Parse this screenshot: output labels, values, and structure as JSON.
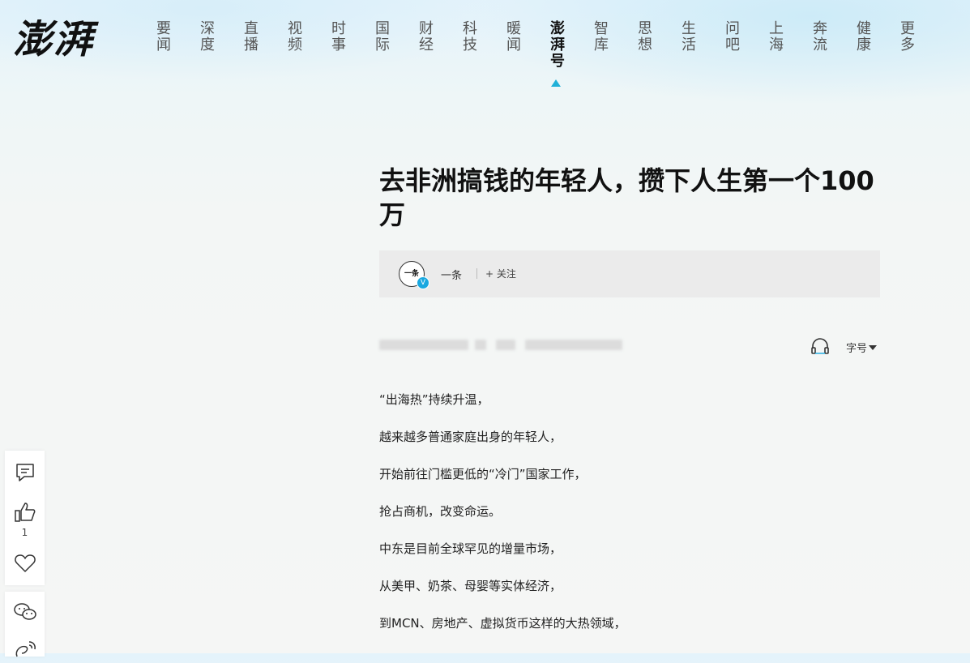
{
  "logo": "澎湃",
  "nav": [
    {
      "label": "要闻",
      "active": false
    },
    {
      "label": "深度",
      "active": false
    },
    {
      "label": "直播",
      "active": false
    },
    {
      "label": "视频",
      "active": false
    },
    {
      "label": "时事",
      "active": false
    },
    {
      "label": "国际",
      "active": false
    },
    {
      "label": "财经",
      "active": false
    },
    {
      "label": "科技",
      "active": false
    },
    {
      "label": "暖闻",
      "active": false
    },
    {
      "label": "澎湃号",
      "active": true
    },
    {
      "label": "智库",
      "active": false
    },
    {
      "label": "思想",
      "active": false
    },
    {
      "label": "生活",
      "active": false
    },
    {
      "label": "问吧",
      "active": false
    },
    {
      "label": "上海",
      "active": false
    },
    {
      "label": "奔流",
      "active": false
    },
    {
      "label": "健康",
      "active": false
    },
    {
      "label": "更多",
      "active": false
    }
  ],
  "article": {
    "title": "去非洲搞钱的年轻人，攒下人生第一个100万",
    "author": {
      "avatar_text": "一条",
      "verified_mark": "V",
      "name": "一条",
      "follow_label": "+ 关注"
    },
    "font_size_label": "字号",
    "paragraphs": [
      "“出海热”持续升温，",
      "越来越多普通家庭出身的年轻人，",
      "开始前往门槛更低的“冷门”国家工作，",
      "抢占商机，改变命运。",
      "中东是目前全球罕见的增量市场，",
      "从美甲、奶茶、母婴等实体经济，",
      "到MCN、房地产、虚拟货币这样的大热领域，"
    ]
  },
  "sidebar": {
    "like_count": "1"
  },
  "colors": {
    "accent": "#1fb0d8",
    "verified": "#19a8e0",
    "author_bar_bg": "#ebebeb"
  },
  "icons": [
    "comment-icon",
    "thumbs-up-icon",
    "heart-icon",
    "wechat-icon",
    "weibo-icon",
    "headphone-icon",
    "caret-down-icon"
  ]
}
